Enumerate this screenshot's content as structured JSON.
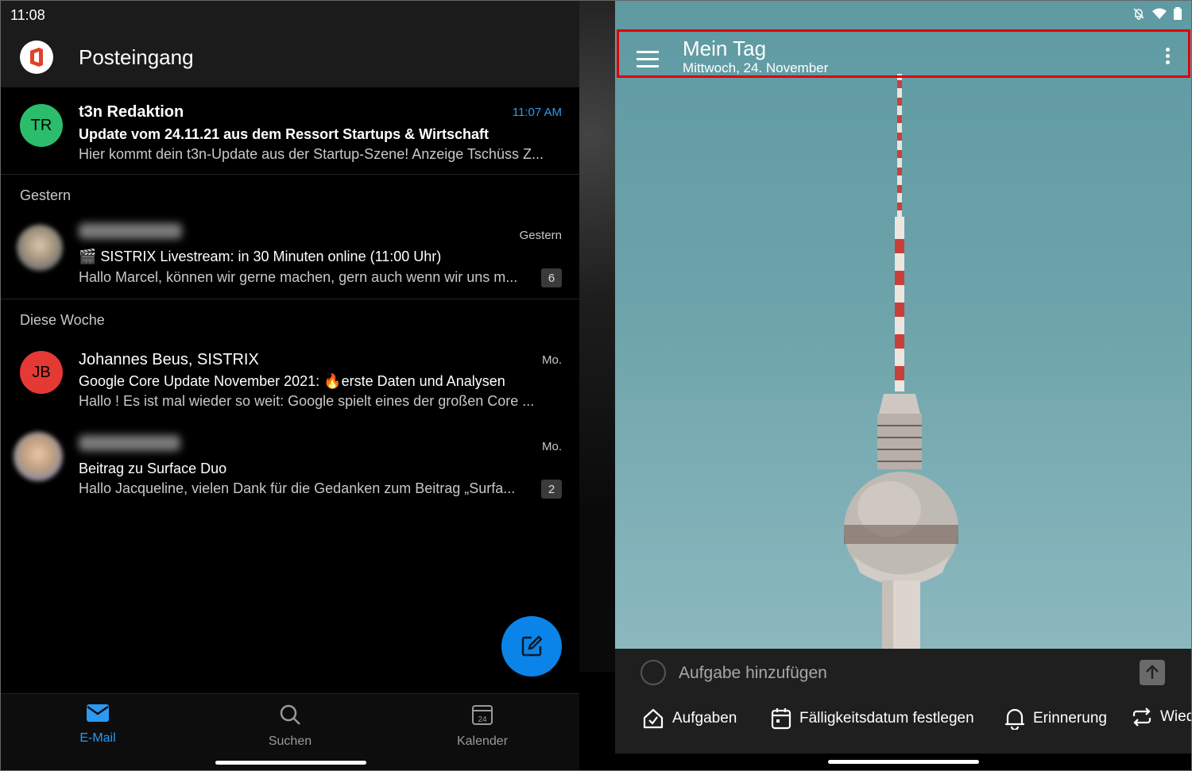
{
  "status_left": {
    "time": "11:08"
  },
  "header": {
    "title": "Posteingang"
  },
  "sections": {
    "yesterday": "Gestern",
    "this_week": "Diese Woche"
  },
  "mails": [
    {
      "initials": "TR",
      "sender": "t3n Redaktion",
      "time": "11:07 AM",
      "subject": "Update vom 24.11.21 aus dem Ressort Startups & Wirtschaft",
      "preview": "Hier kommt dein t3n-Update aus der Startup-Szene! Anzeige Tschüss Z...",
      "avatar_color": "#2bbd6b"
    },
    {
      "time": "Gestern",
      "subject": "🎬 SISTRIX Livestream: in 30 Minuten online (11:00 Uhr)",
      "preview": "Hallo Marcel, können wir gerne machen, gern auch wenn wir uns m...",
      "count": "6"
    },
    {
      "initials": "JB",
      "sender": "Johannes Beus, SISTRIX",
      "time": "Mo.",
      "subject": "Google Core Update November 2021: 🔥erste Daten und Analysen",
      "preview": "Hallo ! Es ist mal wieder so weit: Google spielt eines der großen Core ...",
      "avatar_color": "#e53935"
    },
    {
      "time": "Mo.",
      "subject": "Beitrag zu Surface Duo",
      "preview": "Hallo Jacqueline, vielen Dank für die Gedanken zum Beitrag „Surfa...",
      "count": "2"
    }
  ],
  "nav": {
    "mail": "E-Mail",
    "search": "Suchen",
    "calendar": "Kalender",
    "calendar_day": "24"
  },
  "colors": {
    "accent": "#0a84e8",
    "highlight_border": "#e00000"
  },
  "todo": {
    "title": "Mein Tag",
    "date": "Mittwoch, 24. November",
    "add_placeholder": "Aufgabe hinzufügen",
    "chips": {
      "tasks": "Aufgaben",
      "due": "Fälligkeitsdatum festlegen",
      "reminder": "Erinnerung",
      "repeat": "Wied"
    }
  }
}
